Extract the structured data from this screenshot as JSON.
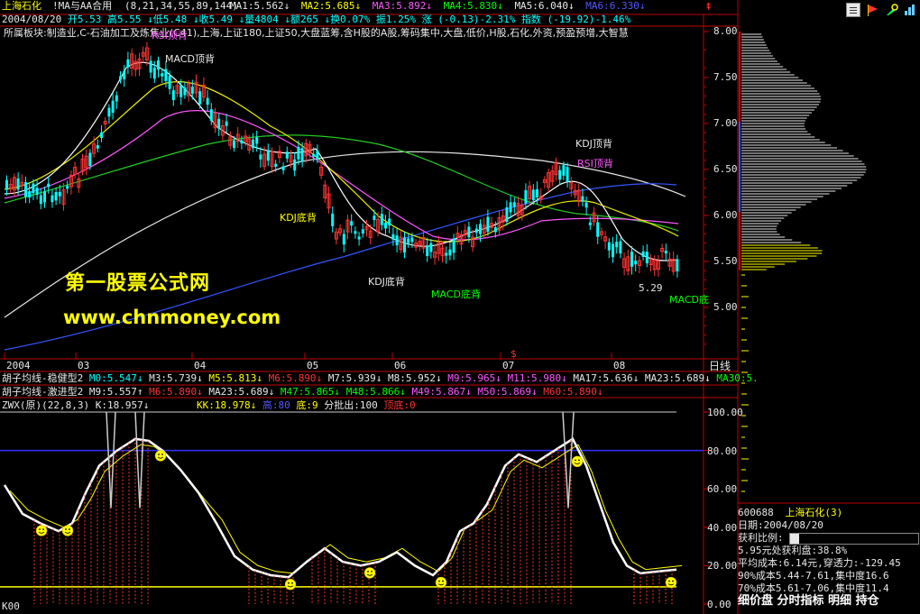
{
  "header": {
    "stock_name": "上海石化",
    "indicator_name": "!MA与AA合用",
    "indicator_params": "(8,21,34,55,89,144)",
    "ma_values": [
      {
        "label": "MA1:5.562",
        "arrow": "↓",
        "color": "#e8e8e8"
      },
      {
        "label": "MA2:5.685",
        "arrow": "↓",
        "color": "#ffff00"
      },
      {
        "label": "MA3:5.892",
        "arrow": "↓",
        "color": "#ff55ff"
      },
      {
        "label": "MA4:5.830",
        "arrow": "↓",
        "color": "#00ff00"
      },
      {
        "label": "MA5:6.040",
        "arrow": "↓",
        "color": "#e8e8e8"
      },
      {
        "label": "MA6:6.330",
        "arrow": "↓",
        "color": "#5555ff"
      }
    ],
    "quote_line": [
      {
        "text": "2004/08/20",
        "color": "#e8e8e8"
      },
      {
        "text": "开5.53",
        "color": "#00ffff"
      },
      {
        "text": "高5.55",
        "color": "#00ffff"
      },
      {
        "text": "↓低5.48",
        "color": "#00ffff"
      },
      {
        "text": "↓收5.49",
        "color": "#00ffff"
      },
      {
        "text": "↓量4804",
        "color": "#00ffff"
      },
      {
        "text": "↓额265",
        "color": "#00ffff"
      },
      {
        "text": "↓换0.07%",
        "color": "#00ffff"
      },
      {
        "text": "振1.25%",
        "color": "#00ffff"
      },
      {
        "text": "涨 (-0.13)-2.31%",
        "color": "#00ffff"
      },
      {
        "text": "指数 (-19.92)-1.46%",
        "color": "#00ffff"
      }
    ],
    "sector_line": "所属板块:制造业,C-石油加工及炼焦业(C41),上海,上证180,上证50,大盘蓝筹,含H股的A股,筹码集中,大盘,低价,H股,石化,外资,预盈预增,大智慧"
  },
  "price_axis": {
    "ticks": [
      "8.00",
      "7.50",
      "7.00",
      "6.50",
      "6.00",
      "5.50",
      "5.00"
    ],
    "period_label": "日线"
  },
  "date_axis": {
    "labels": [
      "2004",
      "03",
      "04",
      "05",
      "06",
      "07",
      "08"
    ]
  },
  "annotations": {
    "macd_top": "MACD顶背",
    "kdj_top": "KDJ顶背",
    "rsi_top": "RSI顶背",
    "kdj_bottom_1": "KDJ底背",
    "kdj_bottom_2": "KDJ底背",
    "macd_bottom_1": "MACD底背",
    "macd_bottom_2": "MACD底",
    "rsi_top_left": "RSI顶背",
    "low_price": "5.29",
    "weight_marker": "$"
  },
  "watermark": {
    "line1": "第一股票公式网",
    "line2": "www.chnmoney.com"
  },
  "legend_rows": [
    {
      "title": "胡子均线-稳健型2",
      "items": [
        {
          "text": "M0:5.547↓",
          "color": "#00ffff"
        },
        {
          "text": "M3:5.739↓",
          "color": "#e8e8e8"
        },
        {
          "text": "M5:5.813↓",
          "color": "#ffff00"
        },
        {
          "text": "M6:5.890↓",
          "color": "#ff3333"
        },
        {
          "text": "M7:5.939↓",
          "color": "#e8e8e8"
        },
        {
          "text": "M8:5.952↓",
          "color": "#e8e8e8"
        },
        {
          "text": "M9:5.965↓",
          "color": "#ff55ff"
        },
        {
          "text": "M11:5.980↓",
          "color": "#ff55ff"
        },
        {
          "text": "MA17:5.636↓",
          "color": "#e8e8e8"
        },
        {
          "text": "MA23:5.689↓",
          "color": "#e8e8e8"
        },
        {
          "text": "MA30:5.",
          "color": "#00ff00"
        }
      ]
    },
    {
      "title": "胡子均线-激进型2",
      "items": [
        {
          "text": "M9:5.557↑",
          "color": "#e8e8e8"
        },
        {
          "text": "M6:5.890↓",
          "color": "#ff3333"
        },
        {
          "text": "MA23:5.689↓",
          "color": "#e8e8e8"
        },
        {
          "text": "M47:5.865↓",
          "color": "#00ff00"
        },
        {
          "text": "M48:5.866↓",
          "color": "#00ff00"
        },
        {
          "text": "M49:5.867↓",
          "color": "#ff55ff"
        },
        {
          "text": "M50:5.869↓",
          "color": "#ff55ff"
        },
        {
          "text": "M60:5.890↓",
          "color": "#ff3333"
        }
      ]
    }
  ],
  "sub_indicator": {
    "name": "ZWX(原)(22,8,3)",
    "k": "K:18.957↓",
    "kk": "KK:18.978↓",
    "high": "高:80",
    "bottom": "底:9",
    "batch_out": "分批出:100",
    "top": "顶底:0",
    "ticks": [
      "100.00",
      "80.00",
      "60.00",
      "40.00",
      "20.00",
      "0.00"
    ],
    "bottom_left": "K00"
  },
  "chip_panel": {
    "code": "600688",
    "name": "上海石化(3)",
    "date": "日期:2004/08/20",
    "ratio_label": "获利比例:",
    "ratio_value": "7.1%",
    "ratio_fraction": 0.071,
    "profit_line": "5.95元处获利盘:38.8%",
    "avg_cost": "平均成本:6.14元,穿透力:-129.45",
    "cost90": "90%成本5.44-7.61,集中度16.6",
    "cost70": "70%成本5.61-7.06,集中度11.4",
    "footer": "细价盘 分时指标 明细 持仓"
  }
}
